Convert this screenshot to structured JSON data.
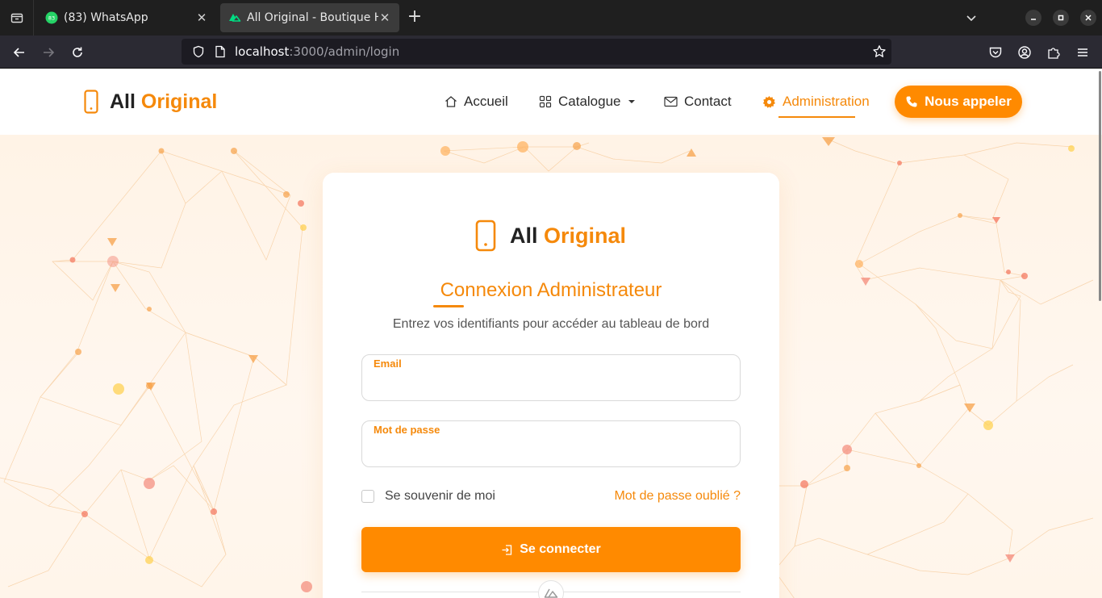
{
  "browser": {
    "tabs": [
      {
        "title": "(83) WhatsApp",
        "badge": "83",
        "icon": "whatsapp-icon"
      },
      {
        "title": "All Original - Boutique High-Tech",
        "icon": "nuxt-icon",
        "active": true
      }
    ],
    "url_host": "localhost",
    "url_rest": ":3000/admin/login"
  },
  "site": {
    "brand_part1": "All",
    "brand_part2": "Original",
    "accent_color": "#f5890b",
    "nav": {
      "home": "Accueil",
      "catalog": "Catalogue",
      "contact": "Contact",
      "admin": "Administration",
      "call": "Nous appeler"
    }
  },
  "login": {
    "brand_part1": "All",
    "brand_part2": "Original",
    "title": "Connexion Administrateur",
    "subtitle": "Entrez vos identifiants pour accéder au tableau de bord",
    "email_label": "Email",
    "email_value": "",
    "password_label": "Mot de passe",
    "password_value": "",
    "remember_label": "Se souvenir de moi",
    "forgot_label": "Mot de passe oublié ?",
    "submit_label": "Se connecter"
  }
}
